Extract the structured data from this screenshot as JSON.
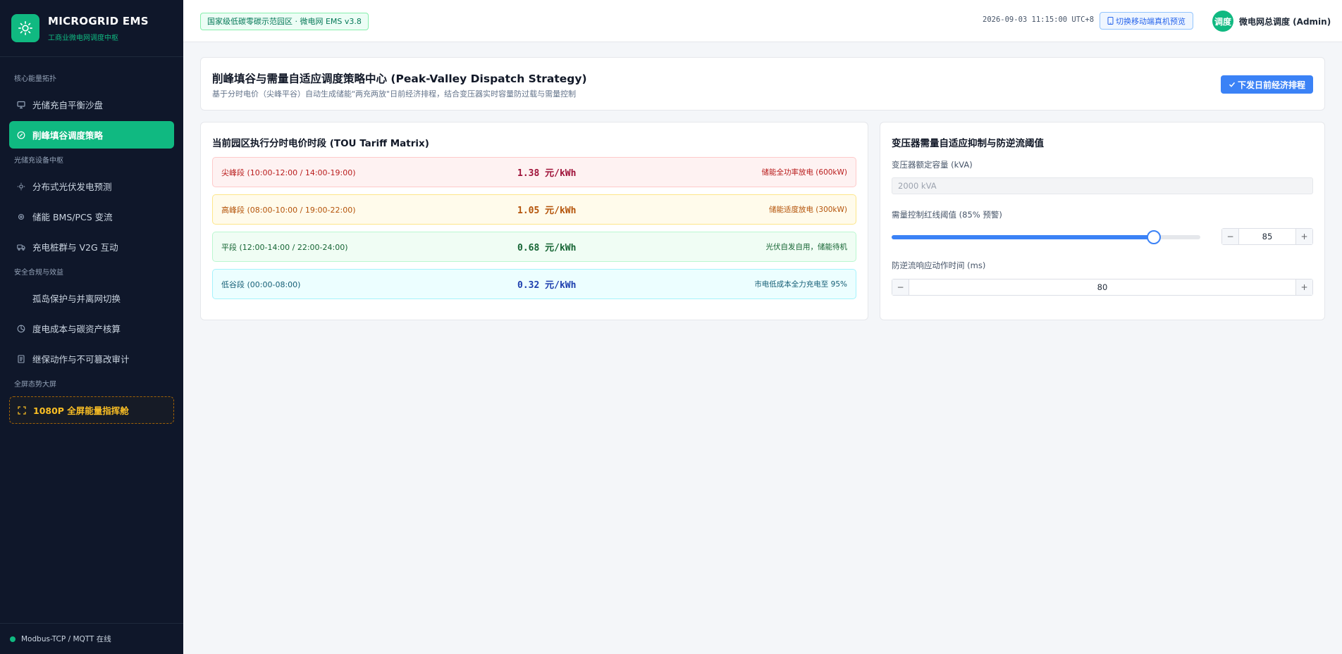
{
  "brand": {
    "title": "MICROGRID EMS",
    "subtitle": "工商业微电网调度中枢"
  },
  "sidebar": {
    "sections": [
      {
        "label": "核心能量拓扑"
      },
      {
        "label": "光储充设备中枢"
      },
      {
        "label": "安全合规与效益"
      },
      {
        "label": "全屏态势大屏"
      }
    ],
    "items": [
      {
        "label": "光储充自平衡沙盘",
        "icon": "monitor-icon"
      },
      {
        "label": "削峰填谷调度策略",
        "icon": "compass-icon",
        "active": true
      },
      {
        "label": "分布式光伏发电预测",
        "icon": "sun-icon"
      },
      {
        "label": "储能 BMS/PCS 变流",
        "icon": "chip-icon"
      },
      {
        "label": "充电桩群与 V2G 互动",
        "icon": "truck-icon"
      },
      {
        "label": "孤岛保护与并离网切换",
        "icon": ""
      },
      {
        "label": "度电成本与碳资产核算",
        "icon": "pie-chart-icon"
      },
      {
        "label": "继保动作与不可篡改审计",
        "icon": "document-icon"
      },
      {
        "label": "1080P 全屏能量指挥舱",
        "icon": "fullscreen-icon"
      }
    ],
    "footer_status": "Modbus-TCP / MQTT 在线"
  },
  "header": {
    "site_badge": "国家级低碳零碳示范园区 · 微电网 EMS v3.8",
    "clock": "2026-09-03 11:15:00 UTC+8",
    "mobile_button": "切换移动端真机预览",
    "avatar_text": "调度",
    "user_name": "微电网总调度 (Admin)"
  },
  "strategy": {
    "title": "削峰填谷与需量自适应调度策略中心 (Peak-Valley Dispatch Strategy)",
    "description": "基于分时电价（尖峰平谷）自动生成储能\"两充两放\"日前经济排程，结合变压器实时容量防过载与需量控制",
    "dispatch_button": "下发日前经济排程"
  },
  "tou": {
    "title": "当前园区执行分时电价时段 (TOU Tariff Matrix)",
    "rows": [
      {
        "name": "尖峰段 (10:00-12:00 / 14:00-19:00)",
        "price": "1.38 元/kWh",
        "note": "储能全功率放电 (600kW)"
      },
      {
        "name": "高峰段 (08:00-10:00 / 19:00-22:00)",
        "price": "1.05 元/kWh",
        "note": "储能适度放电 (300kW)"
      },
      {
        "name": "平段 (12:00-14:00 / 22:00-24:00)",
        "price": "0.68 元/kWh",
        "note": "光伏自发自用，储能待机"
      },
      {
        "name": "低谷段 (00:00-08:00)",
        "price": "0.32 元/kWh",
        "note": "市电低成本全力充电至 95%"
      }
    ]
  },
  "transformer": {
    "title": "变压器需量自适应抑制与防逆流阈值",
    "capacity_label": "变压器额定容量 (kVA)",
    "capacity_value": "2000 kVA",
    "threshold_label": "需量控制红线阈值 (85% 预警)",
    "threshold_value": "85",
    "threshold_percent": 85,
    "response_label": "防逆流响应动作时间 (ms)",
    "response_value": "80"
  },
  "colors": {
    "accent": "#10b981",
    "sidebar_bg": "#0f172a",
    "primary": "#3b82f6"
  }
}
